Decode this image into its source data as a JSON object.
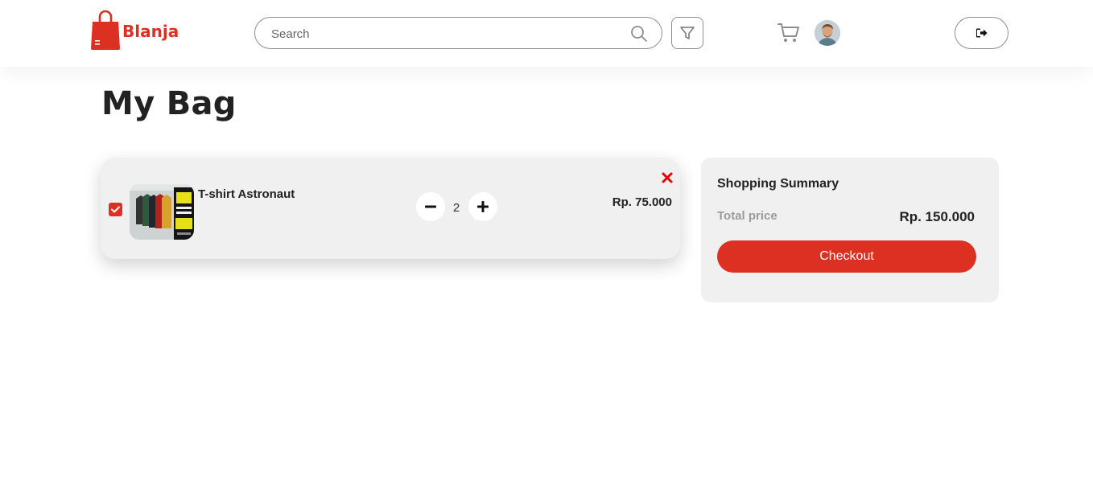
{
  "brand": {
    "name": "Blanja",
    "color": "#db3022"
  },
  "header": {
    "search": {
      "placeholder": "Search",
      "value": ""
    },
    "icons": [
      "search-icon",
      "filter-icon",
      "cart-icon",
      "avatar",
      "logout-icon"
    ]
  },
  "page": {
    "title": "My Bag"
  },
  "cart": {
    "items": [
      {
        "name": "T-shirt Astronaut",
        "checked": true,
        "quantity": "2",
        "price": "Rp. 75.000",
        "image": "tshirt-product-photo"
      }
    ]
  },
  "summary": {
    "title": "Shopping Summary",
    "total_label": "Total price",
    "total_value": "Rp. 150.000",
    "checkout_label": "Checkout"
  },
  "colors": {
    "accent": "#db3022",
    "card_bg": "#f0f0f0",
    "muted_text": "#9b9b9b"
  }
}
